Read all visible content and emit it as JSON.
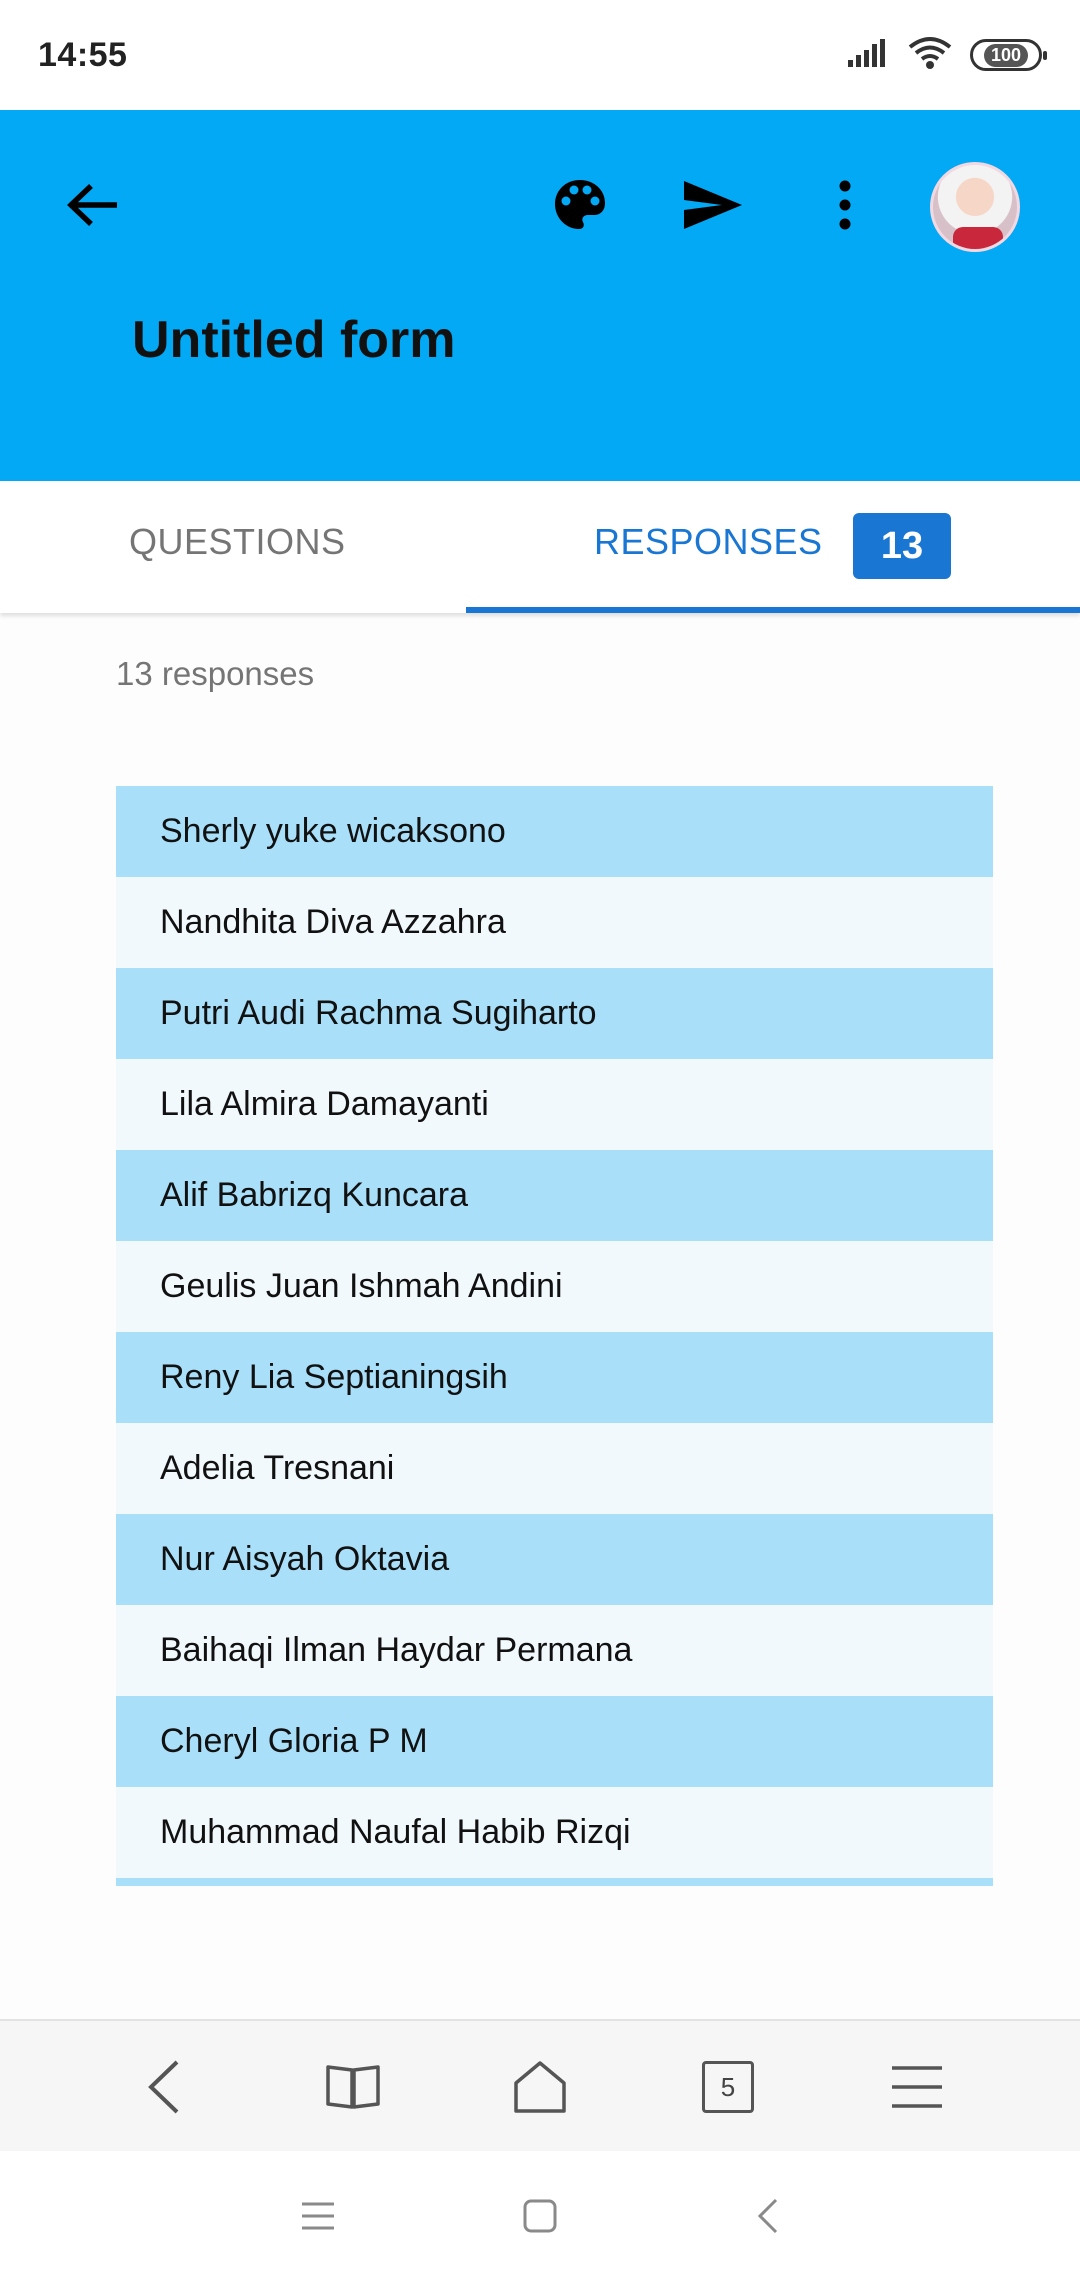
{
  "status_bar": {
    "time": "14:55",
    "battery": "100"
  },
  "header": {
    "title": "Untitled form",
    "icons": [
      "arrow-back-icon",
      "palette-icon",
      "send-icon",
      "more-vert-icon"
    ]
  },
  "tabs": {
    "questions": "QUESTIONS",
    "responses": "RESPONSES",
    "responses_count": "13"
  },
  "responses": {
    "summary": "13 responses",
    "names": [
      "Sherly yuke wicaksono",
      "Nandhita Diva Azzahra",
      "Putri Audi Rachma Sugiharto",
      "Lila Almira Damayanti",
      "Alif Babrizq Kuncara",
      "Geulis Juan Ishmah Andini",
      "Reny Lia Septianingsih",
      "Adelia Tresnani",
      "Nur Aisyah Oktavia",
      "Baihaqi Ilman Haydar Permana",
      "Cheryl Gloria P M",
      "Muhammad Naufal Habib Rizqi"
    ]
  },
  "browser_nav": {
    "tabs_count": "5"
  },
  "colors": {
    "header_bg": "#03a9f4",
    "accent": "#1976d2",
    "row_dark": "#a9dff9",
    "row_light": "#f1f9fd"
  }
}
